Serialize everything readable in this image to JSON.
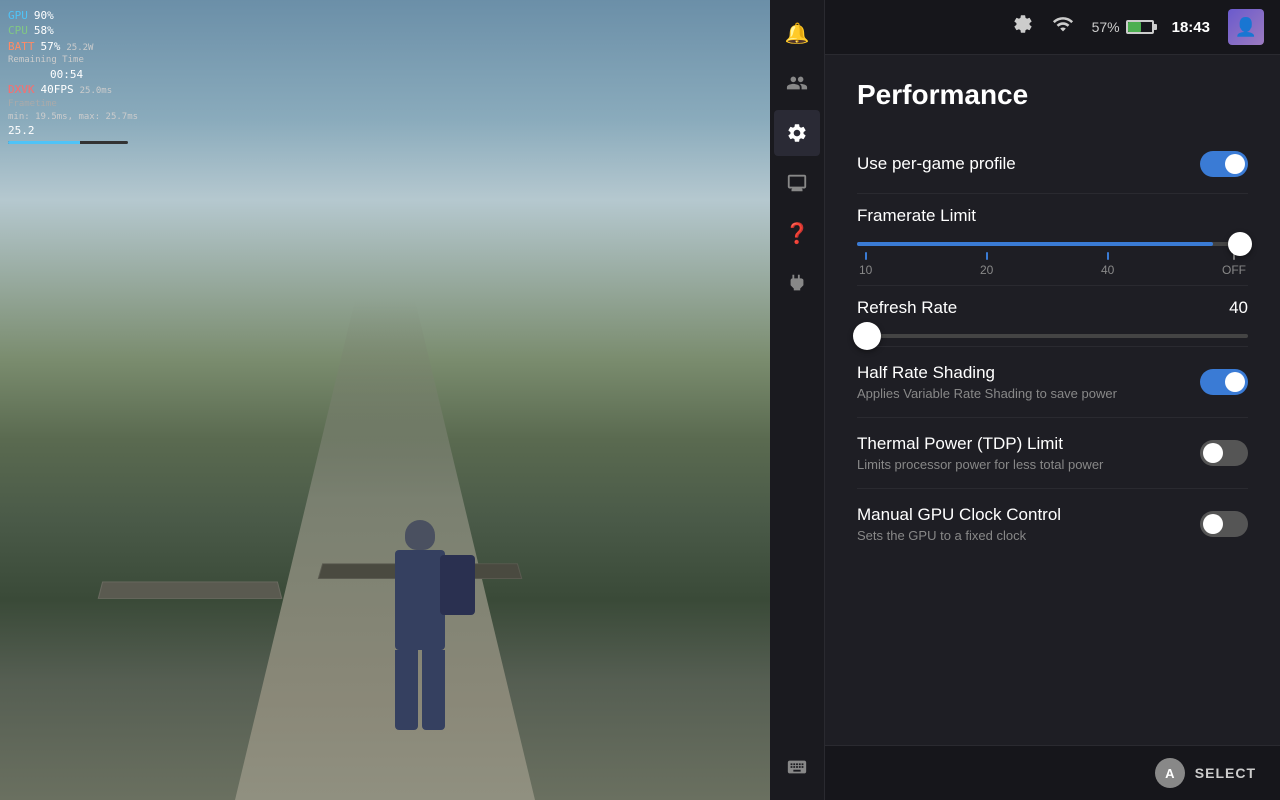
{
  "gameViewport": {
    "hud": {
      "gpu_label": "GPU",
      "gpu_value": "90%",
      "cpu_label": "CPU",
      "cpu_value": "58%",
      "batt_label": "BATT",
      "batt_value": "57%",
      "batt_watts": "25.2W",
      "batt_time_label": "Remaining Time",
      "batt_time": "00:54",
      "dxvk_label": "DXVK",
      "dxvk_fps": "40FPS",
      "dxvk_ms": "25.0ms",
      "frametime_label": "Frametime",
      "frametime_stats": "min: 19.5ms, max: 25.7ms",
      "frametime_val": "25.2"
    }
  },
  "topBar": {
    "battery_pct": "57%",
    "time": "18:43",
    "settings_icon": "⚙",
    "wifi_icon": "📶"
  },
  "sidebar": {
    "items": [
      {
        "id": "notifications",
        "icon": "🔔"
      },
      {
        "id": "friends",
        "icon": "👥"
      },
      {
        "id": "settings",
        "icon": "⚙"
      },
      {
        "id": "display",
        "icon": "🖥"
      },
      {
        "id": "help",
        "icon": "❓"
      },
      {
        "id": "power",
        "icon": "🔌"
      },
      {
        "id": "keyboard",
        "icon": "⌨"
      }
    ]
  },
  "panel": {
    "title": "Performance",
    "settings": [
      {
        "id": "per-game-profile",
        "label": "Use per-game profile",
        "type": "toggle",
        "value": true
      }
    ],
    "framerateLimit": {
      "label": "Framerate Limit",
      "sliderMin": 10,
      "sliderMax": "OFF",
      "ticks": [
        "10",
        "20",
        "40",
        "OFF"
      ],
      "sliderFillPct": 91,
      "thumbPosition": "right"
    },
    "refreshRate": {
      "label": "Refresh Rate",
      "value": "40",
      "sliderFillPct": 0
    },
    "halfRateShading": {
      "label": "Half Rate Shading",
      "sublabel": "Applies Variable Rate Shading to save power",
      "type": "toggle",
      "value": true
    },
    "thermalPowerLimit": {
      "label": "Thermal Power (TDP) Limit",
      "sublabel": "Limits processor power for less total power",
      "type": "toggle",
      "value": false
    },
    "manualGpuClock": {
      "label": "Manual GPU Clock Control",
      "sublabel": "Sets the GPU to a fixed clock",
      "type": "toggle",
      "value": false
    }
  },
  "bottomBar": {
    "button_label": "A",
    "action_label": "SELECT"
  }
}
